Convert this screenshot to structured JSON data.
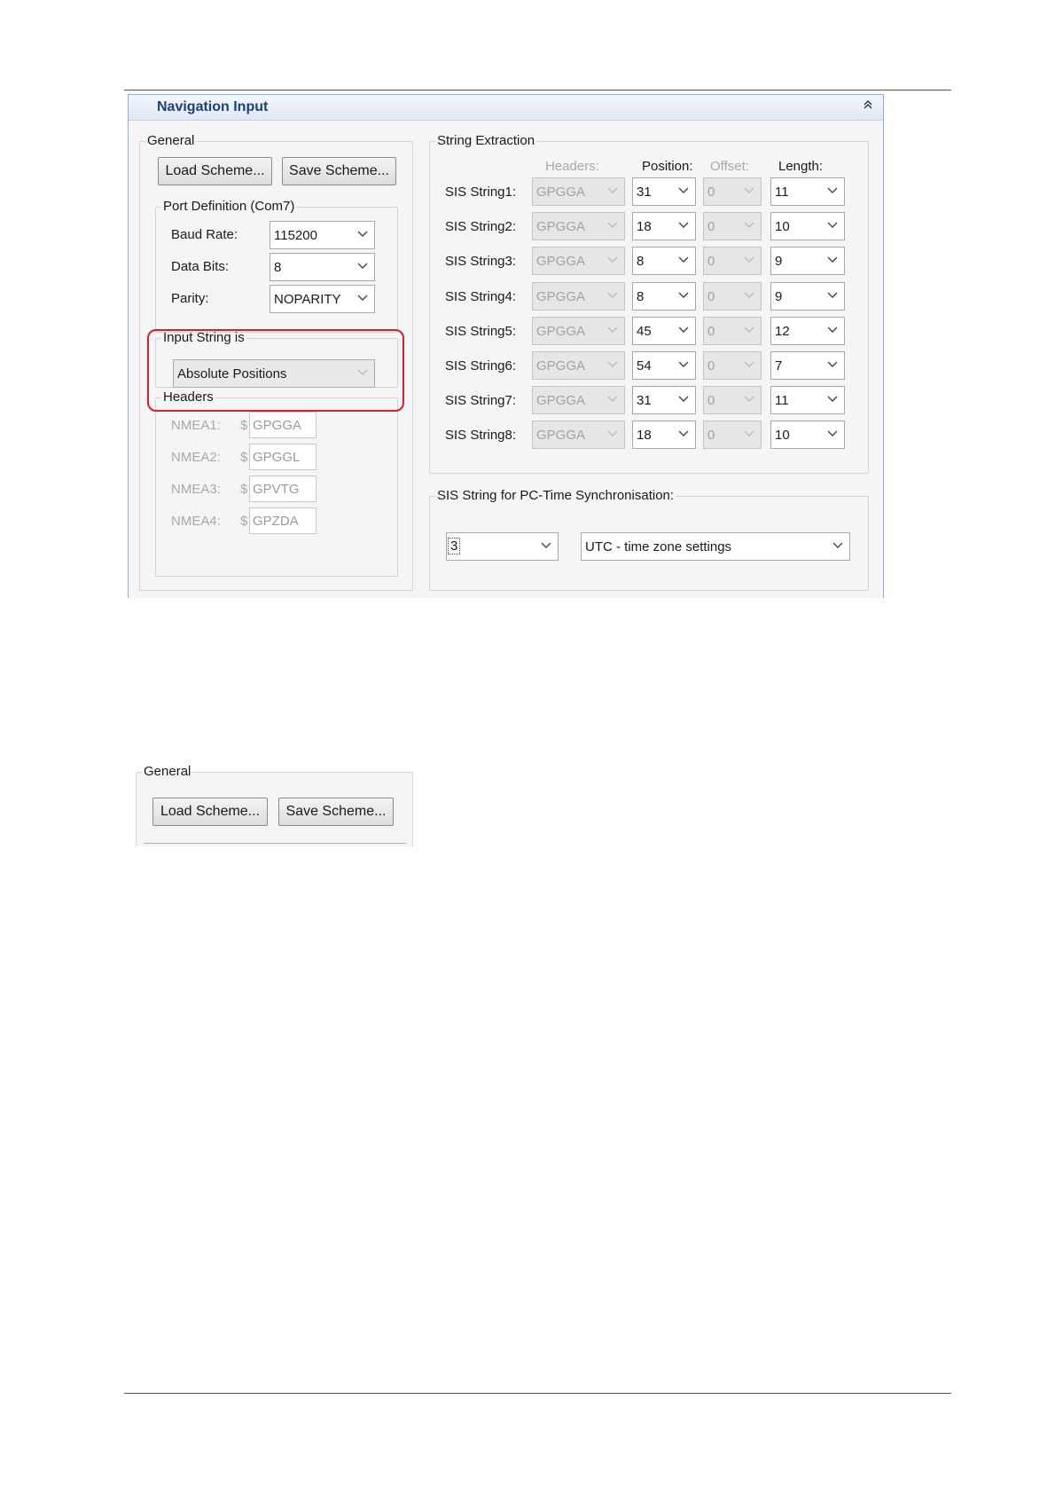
{
  "panel": {
    "title": "Navigation Input"
  },
  "general": {
    "legend": "General",
    "load_label": "Load Scheme...",
    "save_label": "Save Scheme...",
    "port": {
      "legend": "Port Definition (Com7)",
      "baud_label": "Baud Rate:",
      "baud_value": "115200",
      "databits_label": "Data Bits:",
      "databits_value": "8",
      "parity_label": "Parity:",
      "parity_value": "NOPARITY"
    },
    "input_string": {
      "legend": "Input String is",
      "value": "Absolute Positions"
    },
    "headers": {
      "legend": "Headers",
      "items": [
        {
          "label": "NMEA1:",
          "prefix": "$",
          "value": "GPGGA"
        },
        {
          "label": "NMEA2:",
          "prefix": "$",
          "value": "GPGGL"
        },
        {
          "label": "NMEA3:",
          "prefix": "$",
          "value": "GPVTG"
        },
        {
          "label": "NMEA4:",
          "prefix": "$",
          "value": "GPZDA"
        }
      ]
    }
  },
  "extraction": {
    "legend": "String Extraction",
    "col_headers": "Headers:",
    "col_position": "Position:",
    "col_offset": "Offset:",
    "col_length": "Length:",
    "rows": [
      {
        "label": "SIS String1:",
        "header": "GPGGA",
        "position": "31",
        "offset": "0",
        "length": "11"
      },
      {
        "label": "SIS String2:",
        "header": "GPGGA",
        "position": "18",
        "offset": "0",
        "length": "10"
      },
      {
        "label": "SIS String3:",
        "header": "GPGGA",
        "position": "8",
        "offset": "0",
        "length": "9"
      },
      {
        "label": "SIS String4:",
        "header": "GPGGA",
        "position": "8",
        "offset": "0",
        "length": "9"
      },
      {
        "label": "SIS String5:",
        "header": "GPGGA",
        "position": "45",
        "offset": "0",
        "length": "12"
      },
      {
        "label": "SIS String6:",
        "header": "GPGGA",
        "position": "54",
        "offset": "0",
        "length": "7"
      },
      {
        "label": "SIS String7:",
        "header": "GPGGA",
        "position": "31",
        "offset": "0",
        "length": "11"
      },
      {
        "label": "SIS String8:",
        "header": "GPGGA",
        "position": "18",
        "offset": "0",
        "length": "10"
      }
    ]
  },
  "sync": {
    "legend": "SIS String for PC-Time Synchronisation:",
    "string_value": "3",
    "timezone_value": "UTC - time zone settings"
  },
  "crop": {
    "legend": "General",
    "load_label": "Load Scheme...",
    "save_label": "Save Scheme..."
  }
}
